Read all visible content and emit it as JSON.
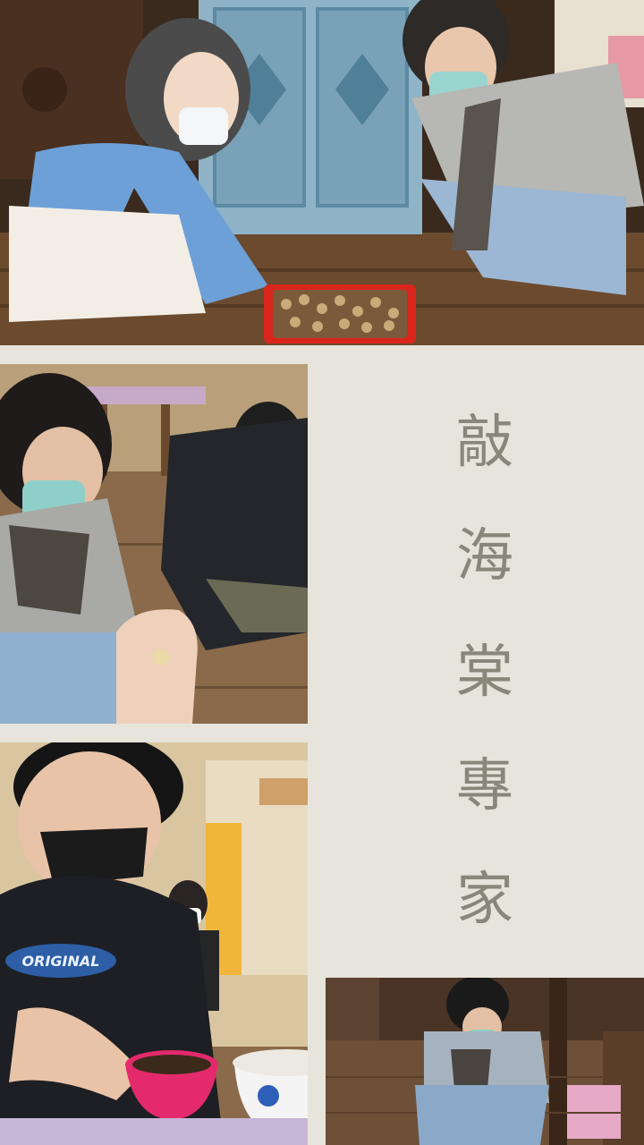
{
  "colors": {
    "background": "#e7e4dc",
    "title_ink": "#87877a"
  },
  "title": {
    "chars": [
      "敲",
      "海",
      "棠",
      "專",
      "家"
    ]
  },
  "photos": {
    "top": {
      "shows": "two people crouching beside a red tray of round seeds in front of a carved blue cabinet"
    },
    "middle": {
      "shows": "open palm holding a small seed while a group works on a wooden floor"
    },
    "lower": {
      "shows": "masked young man using a spoon over a pink bowl of soil"
    },
    "bottom_right": {
      "shows": "woman crouching on a wooden floor"
    }
  },
  "printed_text": {
    "shirt_logo": "ORIGINAL"
  }
}
